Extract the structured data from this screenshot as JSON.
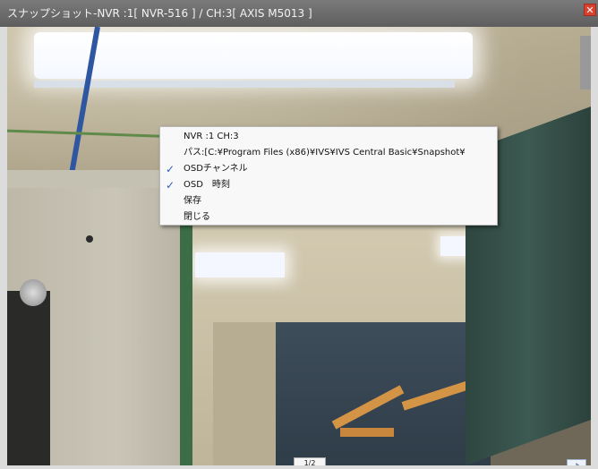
{
  "window": {
    "title": "スナップショット-NVR :1[ NVR-516 ] / CH:3[ AXIS M5013 ]",
    "close_label": "✕"
  },
  "context_menu": {
    "items": [
      {
        "label": "NVR :1 CH:3",
        "checked": false
      },
      {
        "label": "パス:[C:¥Program Files (x86)¥IVS¥IVS Central Basic¥Snapshot¥",
        "checked": false
      },
      {
        "label": "OSDチャンネル",
        "checked": true
      },
      {
        "label": "OSD　時刻",
        "checked": true
      },
      {
        "label": "保存",
        "checked": false
      },
      {
        "label": "閉じる",
        "checked": false
      }
    ],
    "check_mark": "✓"
  },
  "pager": {
    "indicator": "1/2",
    "next_icon": "right-arrow-icon"
  },
  "colors": {
    "titlebar": "#666666",
    "check": "#2a5fbf",
    "close": "#d9412f"
  }
}
